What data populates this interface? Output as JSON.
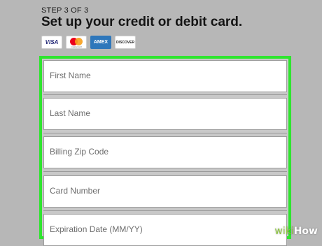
{
  "header": {
    "step": "STEP 3 OF 3",
    "title": "Set up your credit or debit card."
  },
  "cards": {
    "visa": "VISA",
    "mastercard": "mastercard",
    "amex": "AMEX",
    "discover": "DISCOVER"
  },
  "form": {
    "fields": [
      {
        "placeholder": "First Name"
      },
      {
        "placeholder": "Last Name"
      },
      {
        "placeholder": "Billing Zip Code"
      },
      {
        "placeholder": "Card Number"
      },
      {
        "placeholder": "Expiration Date (MM/YY)"
      }
    ],
    "highlight_color": "#2ee52e"
  },
  "watermark": {
    "prefix": "wiki",
    "suffix": "How"
  }
}
